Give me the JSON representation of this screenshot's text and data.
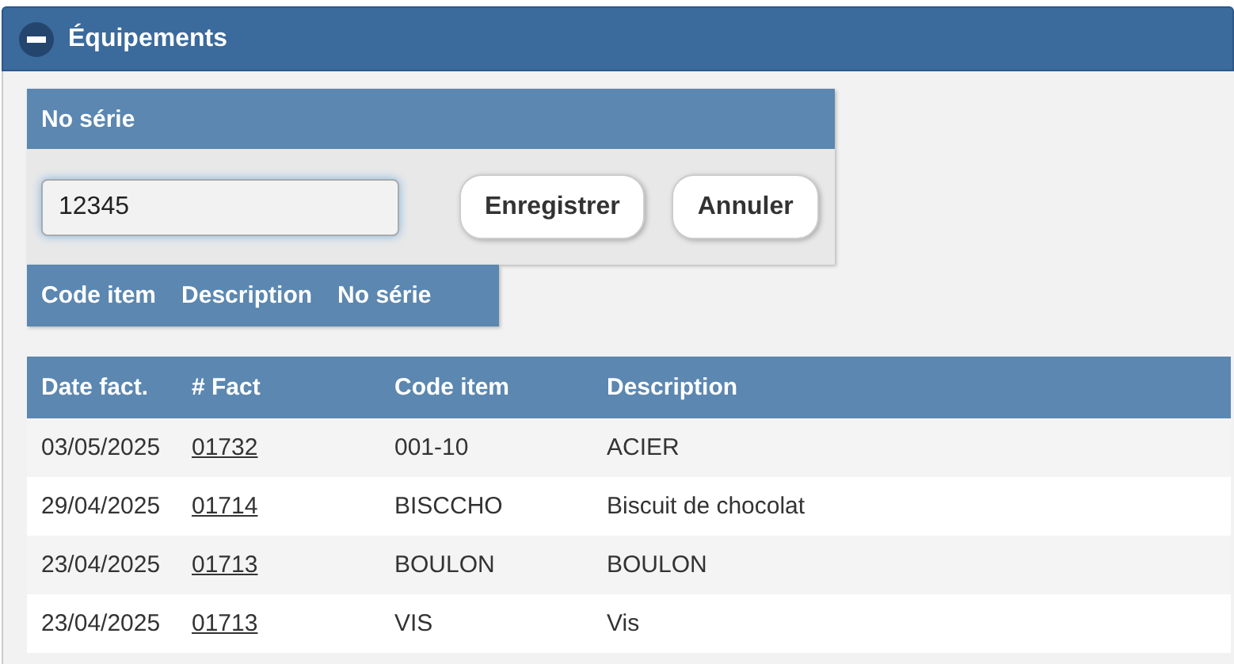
{
  "panel": {
    "title": "Équipements",
    "expanded": true
  },
  "serial_form": {
    "title": "No série",
    "value": "12345",
    "buttons": [
      "Enregistrer",
      "Annuler"
    ]
  },
  "serial_list": {
    "columns": [
      "Code item",
      "Description",
      "No série"
    ]
  },
  "table": {
    "columns": [
      "Date fact.",
      "# Fact",
      "Code item",
      "Description"
    ],
    "rows": [
      {
        "date": "03/05/2025",
        "invoice": "01732",
        "code": "001-10",
        "description": "ACIER"
      },
      {
        "date": "29/04/2025",
        "invoice": "01714",
        "code": "BISCCHO",
        "description": "Biscuit de chocolat"
      },
      {
        "date": "23/04/2025",
        "invoice": "01713",
        "code": "BOULON",
        "description": "BOULON"
      },
      {
        "date": "23/04/2025",
        "invoice": "01713",
        "code": "VIS",
        "description": "Vis"
      }
    ]
  }
}
